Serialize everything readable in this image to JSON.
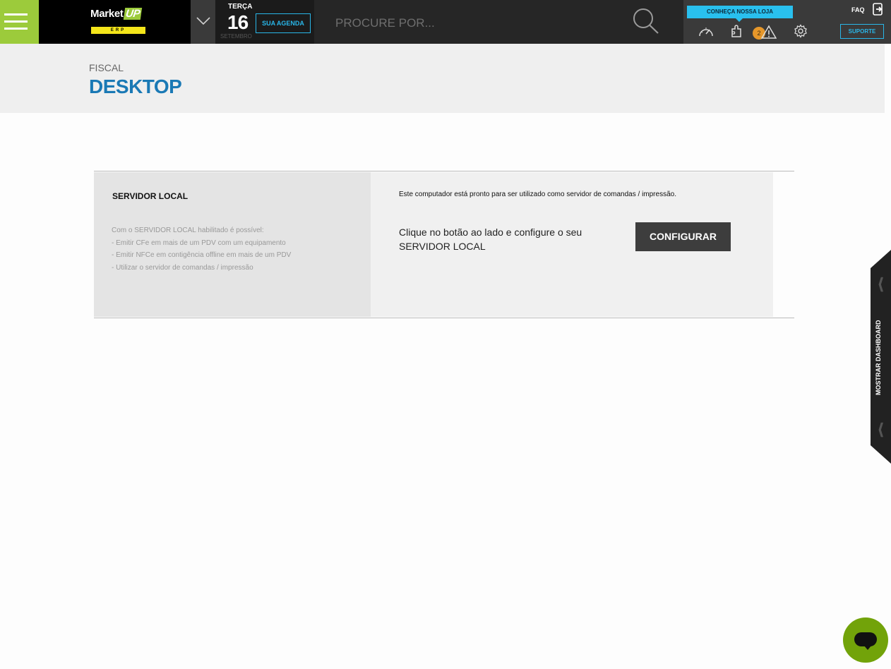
{
  "header": {
    "logo_main": "Market",
    "logo_up": "UP",
    "logo_sub": "ERP",
    "date": {
      "weekday": "TERÇA",
      "day": "16",
      "month": "SETEMBRO"
    },
    "agenda_label": "SUA AGENDA",
    "search": {
      "placeholder": "PROCURE POR..."
    },
    "loja_label": "CONHEÇA NOSSA LOJA",
    "faq_label": "FAQ",
    "notification_count": "2",
    "suporte_label": "SUPORTE"
  },
  "page": {
    "breadcrumb": "FISCAL",
    "title": "DESKTOP"
  },
  "panel": {
    "title": "SERVIDOR LOCAL",
    "description_lines": [
      "Com o SERVIDOR LOCAL habilitado é possível:",
      "- Emitir CFe em mais de um PDV com um equipamento",
      "- Emitir NFCe em contigência offline em mais de um PDV",
      "- Utilizar o servidor de comandas / impressão"
    ],
    "status_text": "Este computador está pronto para ser utilizado como servidor de comandas / impressão.",
    "cta_text": "Clique no botão ao lado e configure o seu SERVIDOR LOCAL",
    "button_label": "CONFIGURAR"
  },
  "dashboard_tab": {
    "label": "MOSTRAR DASHBOARD"
  },
  "colors": {
    "accent_green": "#9ccb3b",
    "accent_blue": "#29b6e8",
    "title_blue": "#1a79b5",
    "badge_orange": "#e6972a"
  },
  "icons": [
    "hamburger-icon",
    "chevron-down-icon",
    "search-icon",
    "logout-icon",
    "speedometer-icon",
    "puzzle-icon",
    "warning-icon",
    "gear-icon",
    "chat-icon"
  ]
}
